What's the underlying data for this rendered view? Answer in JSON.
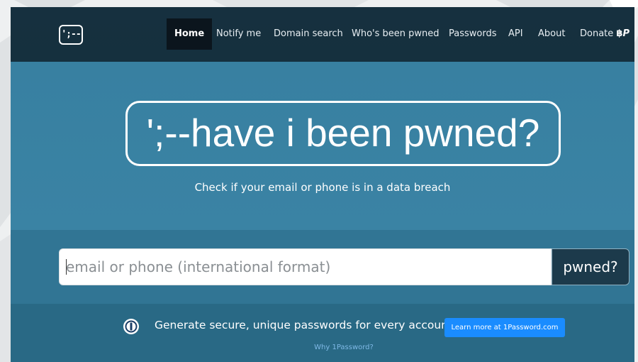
{
  "logo": {
    "text": "';--"
  },
  "nav": {
    "items": [
      {
        "label": "Home",
        "active": true
      },
      {
        "label": "Notify me"
      },
      {
        "label": "Domain search"
      },
      {
        "label": "Who's been pwned"
      },
      {
        "label": "Passwords"
      },
      {
        "label": "API"
      },
      {
        "label": "About"
      },
      {
        "label": "Donate"
      }
    ],
    "donate_icons": [
      "bitcoin-icon",
      "paypal-icon"
    ]
  },
  "hero": {
    "title": "';--have i been pwned?",
    "tagline": "Check if your email or phone is in a data breach"
  },
  "search": {
    "placeholder": "email or phone (international format)",
    "value": "",
    "button_label": "pwned?"
  },
  "promo": {
    "icon": "1password-icon",
    "text": "Generate secure, unique passwords for every account",
    "button_label": "Learn more at 1Password.com",
    "why_link": "Why 1Password?"
  },
  "colors": {
    "navbar": "#16303f",
    "hero": "#3880a1",
    "search_band": "#317594",
    "promo_band": "#296985",
    "promo_button": "#1a8cff",
    "search_button": "#1c3a4b"
  }
}
